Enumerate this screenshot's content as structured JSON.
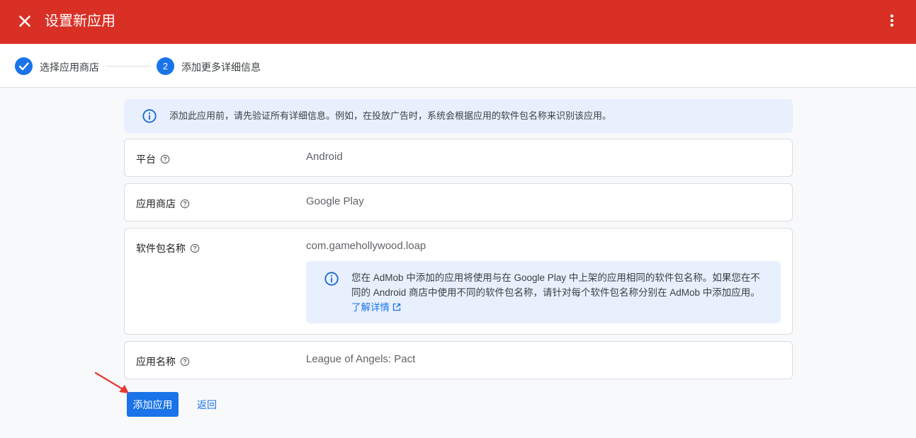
{
  "header": {
    "title": "设置新应用",
    "close_icon": "close-icon",
    "more_icon": "more-vert-icon"
  },
  "stepper": {
    "steps": [
      {
        "label": "选择应用商店",
        "state": "completed"
      },
      {
        "number": "2",
        "label": "添加更多详细信息",
        "state": "active"
      }
    ]
  },
  "info_banner": {
    "text": "添加此应用前，请先验证所有详细信息。例如，在投放广告时，系统会根据应用的软件包名称来识别该应用。"
  },
  "fields": {
    "platform": {
      "label": "平台",
      "value": "Android"
    },
    "store": {
      "label": "应用商店",
      "value": "Google Play"
    },
    "package": {
      "label": "软件包名称",
      "value": "com.gamehollywood.loap",
      "note": {
        "text": "您在 AdMob 中添加的应用将使用与在 Google Play 中上架的应用相同的软件包名称。如果您在不同的 Android 商店中使用不同的软件包名称，请针对每个软件包名称分别在 AdMob 中添加应用。",
        "link": "了解详情"
      }
    },
    "app_name": {
      "label": "应用名称",
      "value": "League of Angels: Pact"
    }
  },
  "actions": {
    "add_label": "添加应用",
    "back_label": "返回"
  },
  "colors": {
    "header": "#d93025",
    "accent": "#1a73e8",
    "info_bg": "#e8f0fe",
    "annotation": "#e53935"
  }
}
